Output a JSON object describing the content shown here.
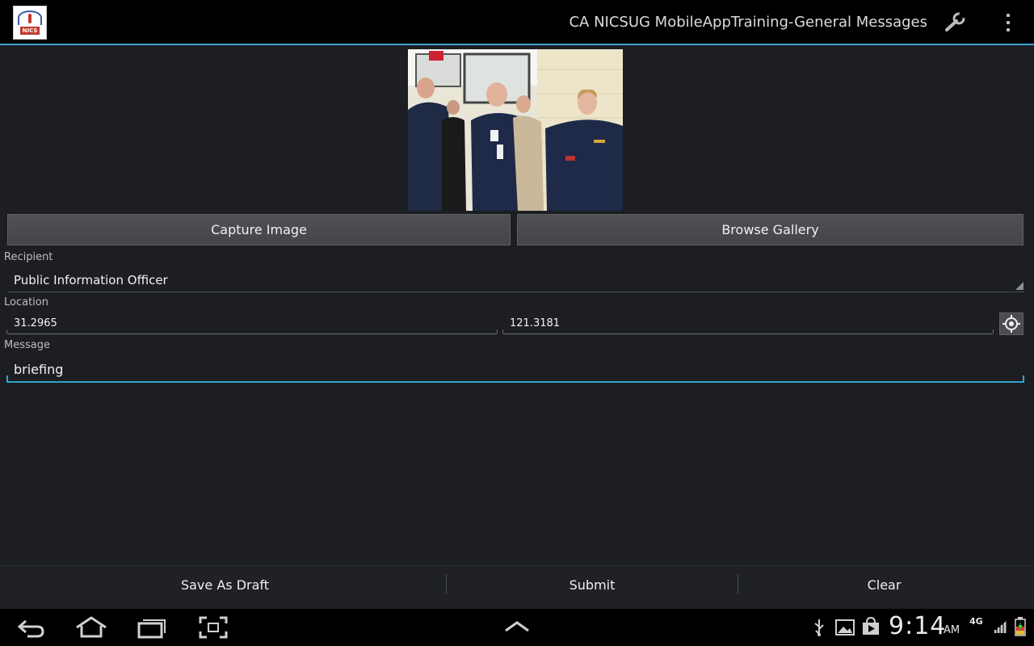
{
  "app": {
    "title": "CA NICSUG MobileAppTraining-General Messages",
    "logo_text": "NICS"
  },
  "photo": {
    "alt": "group-photo"
  },
  "buttons": {
    "capture": "Capture Image",
    "browse": "Browse Gallery"
  },
  "recipient": {
    "label": "Recipient",
    "value": "Public Information Officer"
  },
  "location": {
    "label": "Location",
    "latitude": "31.2965",
    "longitude": "121.3181"
  },
  "message": {
    "label": "Message",
    "value": "briefing"
  },
  "actions": {
    "save_draft": "Save As Draft",
    "submit": "Submit",
    "clear": "Clear"
  },
  "system": {
    "time": "9:14",
    "ampm": "AM",
    "network": "4G"
  },
  "colors": {
    "accent": "#33a3cf",
    "background": "#1c1e22",
    "action_bar": "#000000"
  },
  "icons": [
    "wrench-icon",
    "overflow-menu-icon",
    "gps-target-icon",
    "back-icon",
    "home-icon",
    "recent-apps-icon",
    "screenshot-icon",
    "up-arrow-icon",
    "usb-icon",
    "gallery-icon",
    "play-store-icon",
    "signal-icon",
    "battery-icon"
  ]
}
